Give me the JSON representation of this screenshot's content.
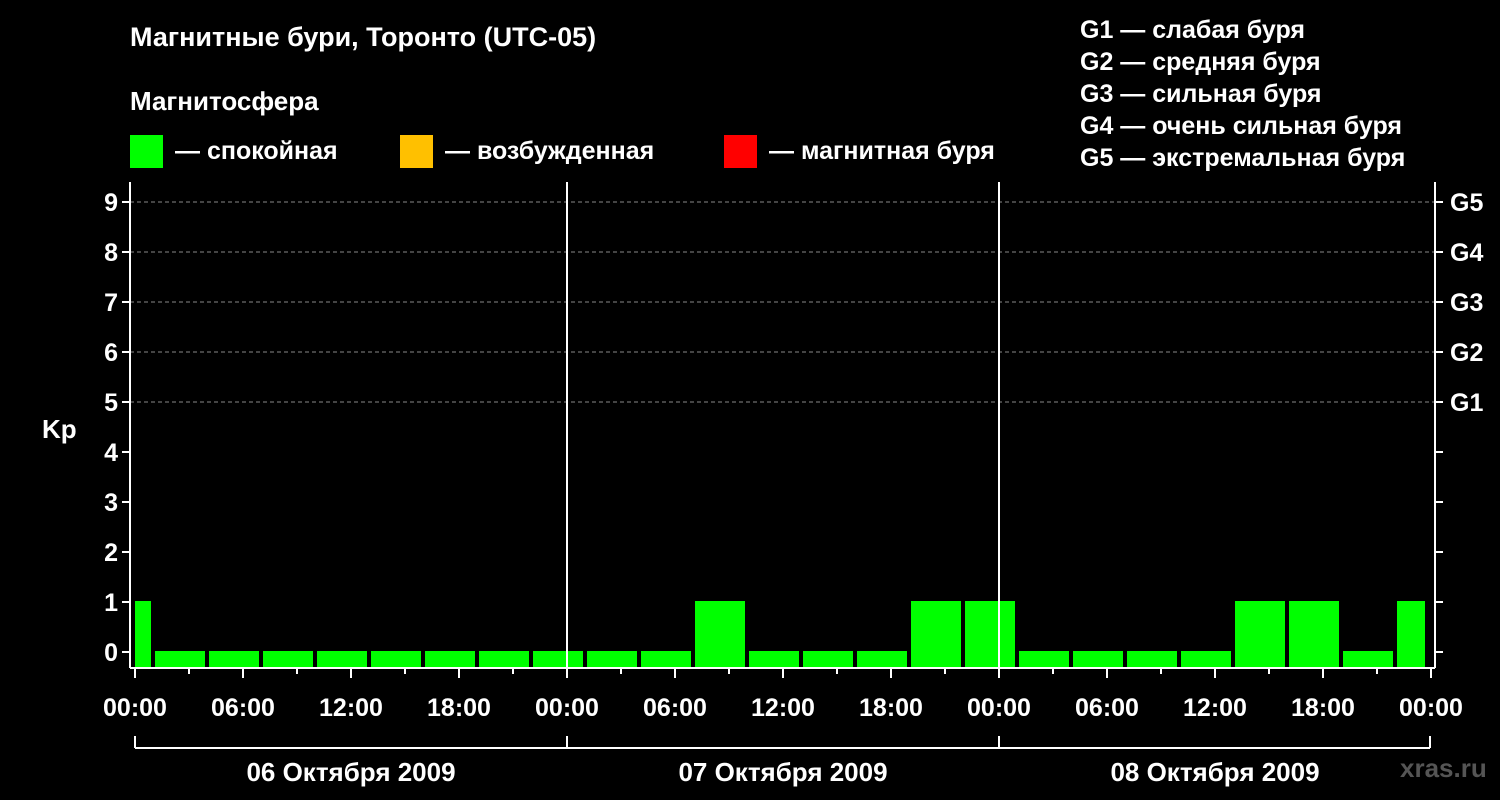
{
  "title": "Магнитные бури, Торонто (UTC-05)",
  "subtitle": "Магнитосфера",
  "legend": [
    {
      "label": "— спокойная",
      "color": "#00ff00"
    },
    {
      "label": "— возбужденная",
      "color": "#ffc000"
    },
    {
      "label": "— магнитная буря",
      "color": "#ff0000"
    }
  ],
  "storm_levels": [
    "G1 — слабая буря",
    "G2 — средняя буря",
    "G3 — сильная буря",
    "G4 — очень сильная буря",
    "G5 — экстремальная буря"
  ],
  "watermark": "xras.ru",
  "chart_data": {
    "type": "bar",
    "ylabel": "Kp",
    "ylim": [
      0,
      9
    ],
    "y_ticks": [
      "0",
      "1",
      "2",
      "3",
      "4",
      "5",
      "6",
      "7",
      "8",
      "9"
    ],
    "right_ticks": [
      {
        "value": 5,
        "label": "G1"
      },
      {
        "value": 6,
        "label": "G2"
      },
      {
        "value": 7,
        "label": "G3"
      },
      {
        "value": 8,
        "label": "G4"
      },
      {
        "value": 9,
        "label": "G5"
      }
    ],
    "x_tick_labels": [
      "00:00",
      "06:00",
      "12:00",
      "18:00",
      "00:00",
      "06:00",
      "12:00",
      "18:00",
      "00:00",
      "06:00",
      "12:00",
      "18:00",
      "00:00"
    ],
    "days": [
      "06 Октября 2009",
      "07 Октября 2009",
      "08 Октября 2009"
    ],
    "bin_hours": 3,
    "start_offset_hours": -2,
    "grid": "dashed at Kp 5-9",
    "quiet_color": "#00ff00",
    "values": [
      1,
      0,
      0,
      0,
      0,
      0,
      0,
      0,
      0,
      0,
      0,
      1,
      0,
      0,
      0,
      1,
      1,
      0,
      0,
      0,
      0,
      1,
      1,
      0,
      1
    ]
  }
}
